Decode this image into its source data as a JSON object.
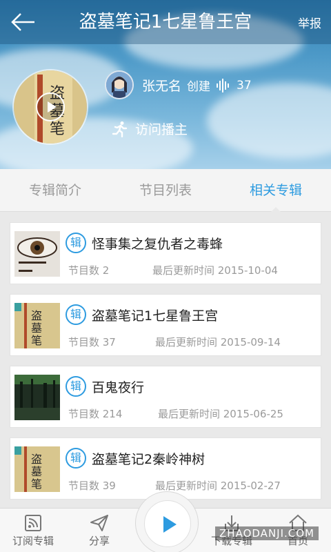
{
  "header": {
    "title": "盗墓笔记1七星鲁王宫",
    "report_label": "举报"
  },
  "album": {
    "creator_name": "张无名",
    "creator_action": "创建",
    "play_count": "37",
    "visit_label": "访问播主"
  },
  "tabs": [
    {
      "label": "专辑简介",
      "active": false
    },
    {
      "label": "节目列表",
      "active": false
    },
    {
      "label": "相关专辑",
      "active": true
    }
  ],
  "related": [
    {
      "badge": "辑",
      "title": "怪事集之复仇者之毒蜂",
      "count_label": "节目数 2",
      "updated_label": "最后更新时间 2015-10-04"
    },
    {
      "badge": "辑",
      "title": "盗墓笔记1七星鲁王宫",
      "count_label": "节目数 37",
      "updated_label": "最后更新时间 2015-09-14"
    },
    {
      "badge": "辑",
      "title": "百鬼夜行",
      "count_label": "节目数 214",
      "updated_label": "最后更新时间 2015-06-25"
    },
    {
      "badge": "辑",
      "title": "盗墓笔记2秦岭神树",
      "count_label": "节目数 39",
      "updated_label": "最后更新时间 2015-02-27"
    }
  ],
  "bottom_nav": {
    "subscribe": "订阅专辑",
    "share": "分享",
    "download": "下载专辑",
    "home": "首页"
  },
  "watermark": "ZHAODANJI.COM",
  "colors": {
    "accent": "#2d9be0",
    "header_bg": "#3f8dc0"
  }
}
